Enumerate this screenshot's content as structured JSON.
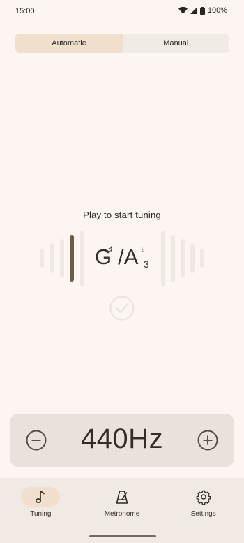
{
  "status_bar": {
    "time": "15:00",
    "battery": "100%"
  },
  "mode_tabs": [
    {
      "label": "Automatic",
      "active": true
    },
    {
      "label": "Manual",
      "active": false
    }
  ],
  "tuner": {
    "prompt": "Play to start tuning",
    "note_primary": "G",
    "note_primary_accidental": "♯",
    "note_separator": "/",
    "note_secondary": "A",
    "note_secondary_accidental": "♭",
    "octave": "3",
    "indicator_color": "#6e5a45",
    "in_tune_icon": "check-circle-icon"
  },
  "reference_pitch": {
    "value": "440Hz",
    "decrease_icon": "minus-circle-icon",
    "increase_icon": "plus-circle-icon"
  },
  "bottom_nav": [
    {
      "label": "Tuning",
      "icon": "music-note-icon",
      "active": true
    },
    {
      "label": "Metronome",
      "icon": "metronome-icon",
      "active": false
    },
    {
      "label": "Settings",
      "icon": "gear-icon",
      "active": false
    }
  ],
  "colors": {
    "background": "#fdf5f1",
    "accent_container": "#efdfcc",
    "panel": "#e9e1db"
  }
}
